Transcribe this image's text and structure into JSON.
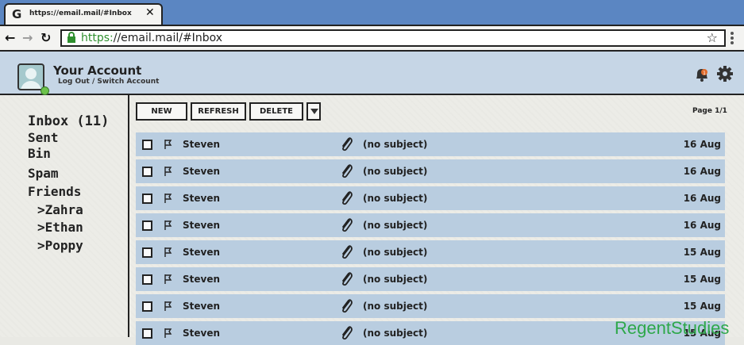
{
  "browser": {
    "tab_title": "https://email.mail/#Inbox",
    "tab_close": "✕",
    "url_scheme": "https:",
    "url_rest": "//email.mail/#Inbox"
  },
  "account": {
    "name": "Your Account",
    "subtitle": "Log Out / Switch Account",
    "notification_count": "1"
  },
  "folders": [
    "Inbox (11)",
    "Sent",
    "Bin",
    "Spam",
    "Friends",
    ">Zahra",
    ">Ethan",
    ">Poppy"
  ],
  "toolbar": {
    "new_label": "NEW",
    "refresh_label": "REFRESH",
    "delete_label": "DELETE",
    "page_info": "Page 1/1"
  },
  "messages": [
    {
      "from": "Steven",
      "subject": "(no subject)",
      "date": "16 Aug"
    },
    {
      "from": "Steven",
      "subject": "(no subject)",
      "date": "16 Aug"
    },
    {
      "from": "Steven",
      "subject": "(no subject)",
      "date": "16 Aug"
    },
    {
      "from": "Steven",
      "subject": "(no subject)",
      "date": "16 Aug"
    },
    {
      "from": "Steven",
      "subject": "(no subject)",
      "date": "15 Aug"
    },
    {
      "from": "Steven",
      "subject": "(no subject)",
      "date": "15 Aug"
    },
    {
      "from": "Steven",
      "subject": "(no subject)",
      "date": "15 Aug"
    },
    {
      "from": "Steven",
      "subject": "(no subject)",
      "date": "15 Aug"
    }
  ],
  "watermark": "RegentStudies",
  "colors": {
    "titlebar": "#5b86c2",
    "header": "#c6d6e6",
    "row": "#b9cde0",
    "online": "#6cc24a",
    "watermark": "#2ea84a"
  }
}
